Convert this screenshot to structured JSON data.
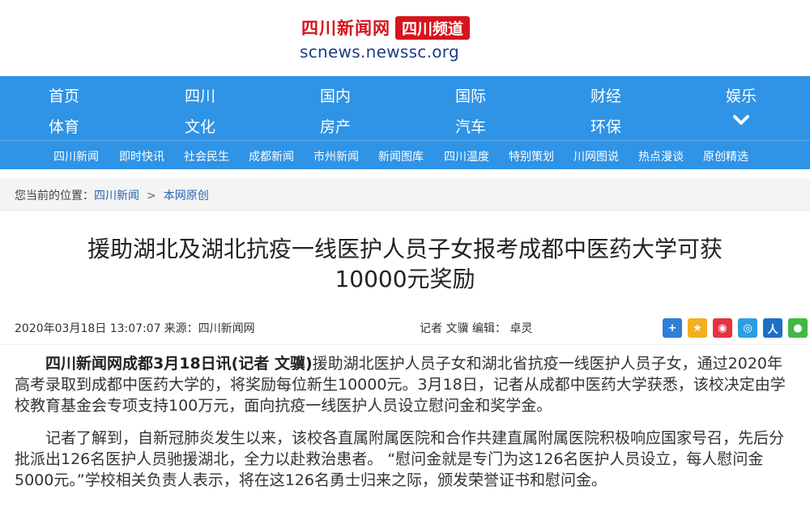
{
  "header": {
    "logo_main": "四川新闻网",
    "logo_badge": "四川频道",
    "domain": "scnews.newssc.org"
  },
  "nav": {
    "row1": [
      "首页",
      "四川",
      "国内",
      "国际",
      "财经",
      "娱乐"
    ],
    "row2": [
      "体育",
      "文化",
      "房产",
      "汽车",
      "环保"
    ],
    "expand_icon": "chevron-down-icon"
  },
  "subnav": [
    "四川新闻",
    "即时快讯",
    "社会民生",
    "成都新闻",
    "市州新闻",
    "新闻图库",
    "四川温度",
    "特别策划",
    "川网图说",
    "热点漫谈",
    "原创精选"
  ],
  "breadcrumb": {
    "prefix": "您当前的位置：",
    "items": [
      "四川新闻",
      "本网原创"
    ],
    "separator": ">"
  },
  "article": {
    "title_line1": "援助湖北及湖北抗疫一线医护人员子女报考成都中医药大学可获",
    "title_line2": "10000元奖励",
    "date": "2020年03月18日 13:07:07",
    "source_label": "来源：",
    "source": "四川新闻网",
    "reporter_label": "记者",
    "reporter": "文骥",
    "editor_label": "编辑：",
    "editor": "卓灵",
    "p1_lead": "四川新闻网成都3月18日讯(记者 文骥)",
    "p1_body": "援助湖北医护人员子女和湖北省抗疫一线医护人员子女，通过2020年高考录取到成都中医药大学的，将奖励每位新生10000元。3月18日，记者从成都中医药大学获悉，该校决定由学校教育基金会专项支持100万元，面向抗疫一线医护人员设立慰问金和奖学金。",
    "p2": "记者了解到，自新冠肺炎发生以来，该校各直属附属医院和合作共建直属附属医院积极响应国家号召，先后分批派出126名医护人员驰援湖北，全力以赴救治患者。 “慰问金就是专门为这126名医护人员设立，每人慰问金5000元。”学校相关负责人表示，将在这126名勇士归来之际，颁发荣誉证书和慰问金。"
  },
  "share": [
    {
      "icon": "share-plus-icon",
      "color": "#2f7fd8",
      "glyph": "+"
    },
    {
      "icon": "qzone-star-icon",
      "color": "#f2b01e",
      "glyph": "★"
    },
    {
      "icon": "weibo-icon",
      "color": "#e8313d",
      "glyph": "◉"
    },
    {
      "icon": "pengyou-icon",
      "color": "#2d9ee6",
      "glyph": "◎"
    },
    {
      "icon": "renren-icon",
      "color": "#1f6fc7",
      "glyph": "人"
    },
    {
      "icon": "wechat-icon",
      "color": "#40b845",
      "glyph": "●"
    }
  ]
}
